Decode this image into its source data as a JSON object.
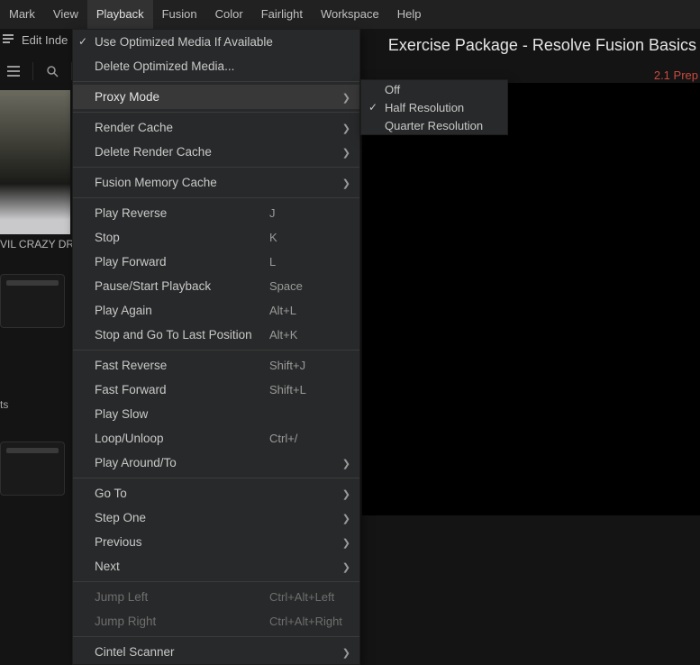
{
  "menubar": {
    "items": [
      "Mark",
      "View",
      "Playback",
      "Fusion",
      "Color",
      "Fairlight",
      "Workspace",
      "Help"
    ],
    "active_index": 2
  },
  "secondary": {
    "edit_index": "Edit Inde"
  },
  "title": "Exercise Package - Resolve Fusion Basics",
  "red_label": "2.1 Prep",
  "thumb_caption": "VIL CRAZY DRIVI",
  "bin_label": "ts",
  "playback_menu": {
    "groups": [
      [
        {
          "label": "Use Optimized Media If Available",
          "checked": true
        },
        {
          "label": "Delete Optimized Media..."
        }
      ],
      [
        {
          "label": "Proxy Mode",
          "submenu": true,
          "hover": true
        }
      ],
      [
        {
          "label": "Render Cache",
          "submenu": true
        },
        {
          "label": "Delete Render Cache",
          "submenu": true
        }
      ],
      [
        {
          "label": "Fusion Memory Cache",
          "submenu": true
        }
      ],
      [
        {
          "label": "Play Reverse",
          "shortcut": "J"
        },
        {
          "label": "Stop",
          "shortcut": "K"
        },
        {
          "label": "Play Forward",
          "shortcut": "L"
        },
        {
          "label": "Pause/Start Playback",
          "shortcut": "Space"
        },
        {
          "label": "Play Again",
          "shortcut": "Alt+L"
        },
        {
          "label": "Stop and Go To Last Position",
          "shortcut": "Alt+K"
        }
      ],
      [
        {
          "label": "Fast Reverse",
          "shortcut": "Shift+J"
        },
        {
          "label": "Fast Forward",
          "shortcut": "Shift+L"
        },
        {
          "label": "Play Slow"
        },
        {
          "label": "Loop/Unloop",
          "shortcut": "Ctrl+/"
        },
        {
          "label": "Play Around/To",
          "submenu": true
        }
      ],
      [
        {
          "label": "Go To",
          "submenu": true
        },
        {
          "label": "Step One",
          "submenu": true
        },
        {
          "label": "Previous",
          "submenu": true
        },
        {
          "label": "Next",
          "submenu": true
        }
      ],
      [
        {
          "label": "Jump Left",
          "shortcut": "Ctrl+Alt+Left",
          "disabled": true
        },
        {
          "label": "Jump Right",
          "shortcut": "Ctrl+Alt+Right",
          "disabled": true
        }
      ],
      [
        {
          "label": "Cintel Scanner",
          "submenu": true
        }
      ]
    ]
  },
  "proxy_submenu": {
    "items": [
      {
        "label": "Off"
      },
      {
        "label": "Half Resolution",
        "checked": true
      },
      {
        "label": "Quarter Resolution"
      }
    ]
  }
}
